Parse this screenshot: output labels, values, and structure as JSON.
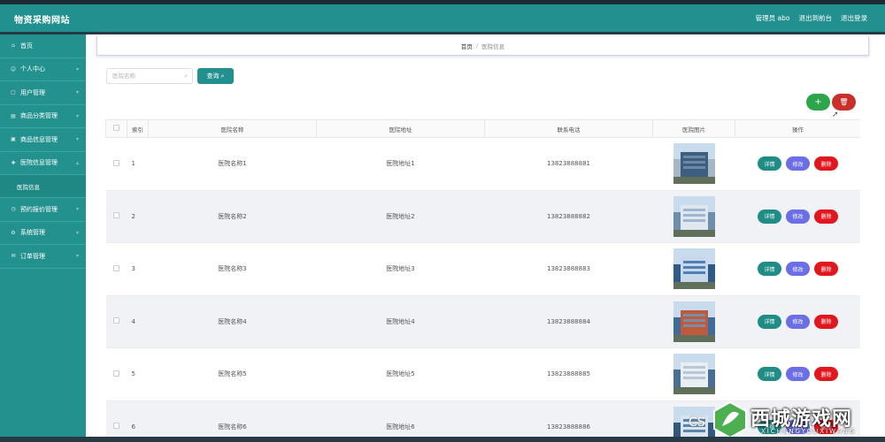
{
  "header": {
    "brand": "物资采购网站",
    "admin_label": "管理员 abo",
    "exit_backend": "退出到前台",
    "logout": "退出登录"
  },
  "sidebar": {
    "items": [
      {
        "label": "首页",
        "icon": "home-icon"
      },
      {
        "label": "个人中心",
        "icon": "user-icon"
      },
      {
        "label": "用户管理",
        "icon": "users-icon"
      },
      {
        "label": "商品分类管理",
        "icon": "category-icon"
      },
      {
        "label": "商品信息管理",
        "icon": "goods-icon"
      },
      {
        "label": "医院信息管理",
        "icon": "hospital-icon"
      },
      {
        "label": "医院信息",
        "icon": ""
      },
      {
        "label": "预约报价管理",
        "icon": "quote-icon"
      },
      {
        "label": "系统管理",
        "icon": "system-icon"
      },
      {
        "label": "订单管理",
        "icon": "order-icon"
      }
    ]
  },
  "breadcrumb": {
    "home": "首页",
    "separator": "/",
    "current": "医院信息"
  },
  "search": {
    "placeholder": "医院名称",
    "button_label": "查询"
  },
  "actions": {
    "add_label": "+",
    "delete_label": "🗑"
  },
  "table": {
    "columns": [
      "索引",
      "医院名称",
      "医院地址",
      "联系电话",
      "医院图片",
      "操作"
    ],
    "op_labels": {
      "detail": "详情",
      "edit": "修改",
      "remove": "删除"
    },
    "rows": [
      {
        "index": "1",
        "name": "医院名称1",
        "address": "医院地址1",
        "phone": "13823888881"
      },
      {
        "index": "2",
        "name": "医院名称2",
        "address": "医院地址2",
        "phone": "13823888882"
      },
      {
        "index": "3",
        "name": "医院名称3",
        "address": "医院地址3",
        "phone": "13823888883"
      },
      {
        "index": "4",
        "name": "医院名称4",
        "address": "医院地址4",
        "phone": "13823888884"
      },
      {
        "index": "5",
        "name": "医院名称5",
        "address": "医院地址5",
        "phone": "13823888885"
      },
      {
        "index": "6",
        "name": "医院名称6",
        "address": "医院地址6",
        "phone": "13823888886"
      }
    ]
  },
  "watermark": {
    "main": "西城游戏网",
    "sub": "XICHENGYOUXIWANG",
    "cs": "CS"
  },
  "colors": {
    "teal": "#21908e",
    "green": "#2da54a",
    "red": "#c9302c",
    "purple": "#6c6ee6"
  }
}
